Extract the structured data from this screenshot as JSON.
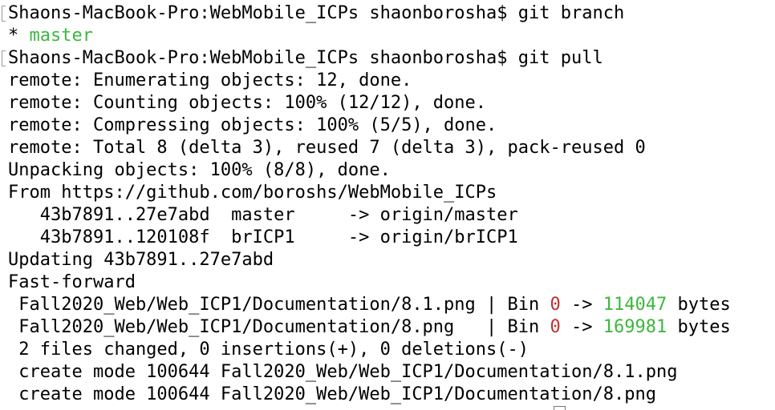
{
  "terminal": {
    "colors": {
      "green": "#3cb83c",
      "red": "#c42d2d",
      "text": "#000000"
    },
    "lines": [
      {
        "kind": "prompt",
        "prompt": "Shaons-MacBook-Pro:WebMobile_ICPs shaonborosha$ ",
        "cmd": "git branch"
      },
      {
        "kind": "branch",
        "star": "* ",
        "name": "master"
      },
      {
        "kind": "prompt",
        "prompt": "Shaons-MacBook-Pro:WebMobile_ICPs shaonborosha$ ",
        "cmd": "git pull"
      },
      {
        "kind": "plain",
        "text": "remote: Enumerating objects: 12, done."
      },
      {
        "kind": "plain",
        "text": "remote: Counting objects: 100% (12/12), done."
      },
      {
        "kind": "plain",
        "text": "remote: Compressing objects: 100% (5/5), done."
      },
      {
        "kind": "plain",
        "text": "remote: Total 8 (delta 3), reused 7 (delta 3), pack-reused 0"
      },
      {
        "kind": "plain",
        "text": "Unpacking objects: 100% (8/8), done."
      },
      {
        "kind": "plain",
        "text": "From https://github.com/boroshs/WebMobile_ICPs"
      },
      {
        "kind": "plain",
        "text": "   43b7891..27e7abd  master     -> origin/master"
      },
      {
        "kind": "plain",
        "text": "   43b7891..120108f  brICP1     -> origin/brICP1"
      },
      {
        "kind": "plain",
        "text": "Updating 43b7891..27e7abd"
      },
      {
        "kind": "plain",
        "text": "Fast-forward"
      },
      {
        "kind": "diff",
        "path": " Fall2020_Web/Web_ICP1/Documentation/8.1.png | Bin ",
        "old": "0",
        "arrow": " -> ",
        "new": "114047",
        "unit": " bytes"
      },
      {
        "kind": "diff",
        "path": " Fall2020_Web/Web_ICP1/Documentation/8.png   | Bin ",
        "old": "0",
        "arrow": " -> ",
        "new": "169981",
        "unit": " bytes"
      },
      {
        "kind": "plain",
        "text": " 2 files changed, 0 insertions(+), 0 deletions(-)"
      },
      {
        "kind": "plain",
        "text": " create mode 100644 Fall2020_Web/Web_ICP1/Documentation/8.1.png"
      },
      {
        "kind": "plain",
        "text": " create mode 100644 Fall2020_Web/Web_ICP1/Documentation/8.png"
      }
    ]
  }
}
